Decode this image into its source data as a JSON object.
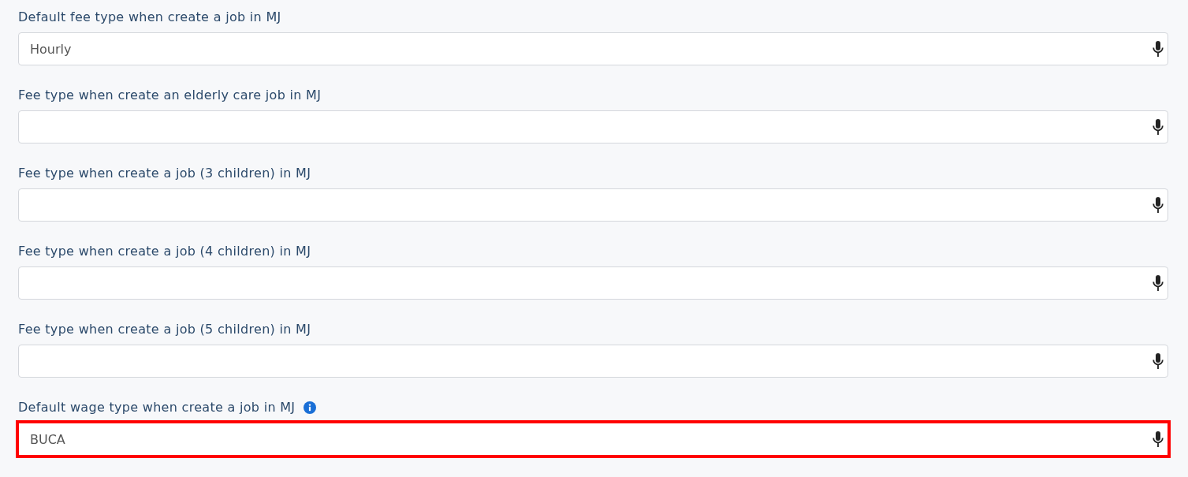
{
  "fields": [
    {
      "label": "Default fee type when create a job in MJ",
      "value": "Hourly",
      "info": false,
      "highlighted": false
    },
    {
      "label": "Fee type when create an elderly care job in MJ",
      "info": false,
      "highlighted": false
    },
    {
      "label": "Fee type when create a job (3 children) in MJ",
      "info": false,
      "highlighted": false
    },
    {
      "label": "Fee type when create a job (4 children) in MJ",
      "info": false,
      "highlighted": false
    },
    {
      "label": "Fee type when create a job (5 children) in MJ",
      "info": false,
      "highlighted": false
    },
    {
      "label": "Default wage type when create a job in MJ",
      "value": "BUCA",
      "info": true,
      "highlighted": true
    }
  ]
}
